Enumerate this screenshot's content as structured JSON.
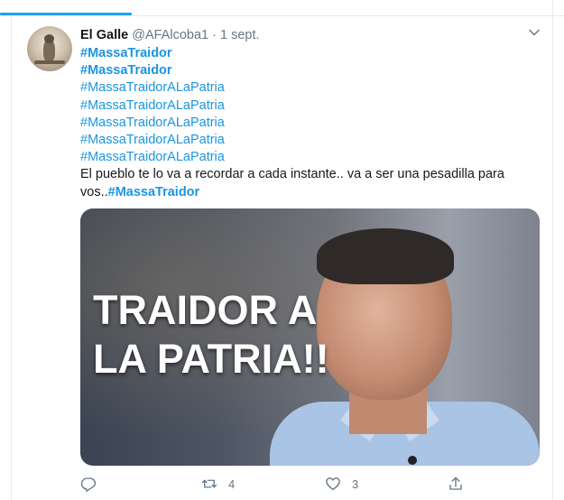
{
  "tweet": {
    "author_name": "El Galle",
    "handle": "@AFAlcoba1",
    "separator": "·",
    "date": "1 sept.",
    "lines": [
      {
        "text": "#MassaTraidor",
        "hashtag": true,
        "bold": true
      },
      {
        "text": "#MassaTraidor",
        "hashtag": true,
        "bold": true
      },
      {
        "text": "#MassaTraidorALaPatria",
        "hashtag": true,
        "bold": false
      },
      {
        "text": "#MassaTraidorALaPatria",
        "hashtag": true,
        "bold": false
      },
      {
        "text": "#MassaTraidorALaPatria",
        "hashtag": true,
        "bold": false
      },
      {
        "text": "#MassaTraidorALaPatria",
        "hashtag": true,
        "bold": false
      },
      {
        "text": "#MassaTraidorALaPatria",
        "hashtag": true,
        "bold": false
      }
    ],
    "body_text": "El pueblo te lo va a recordar a cada instante.. va a ser una pesadilla para",
    "body_text_2": "vos..",
    "body_hashtag": "#MassaTraidor",
    "media_caption_1": "TRAIDOR A",
    "media_caption_2": "LA PATRIA!!",
    "actions": {
      "reply_count": "",
      "retweet_count": "4",
      "like_count": "3",
      "share_count": ""
    }
  },
  "icons": {
    "reply": "reply-icon",
    "retweet": "retweet-icon",
    "like": "heart-icon",
    "share": "share-icon",
    "caret": "chevron-down-icon"
  },
  "colors": {
    "accent": "#1b95e0",
    "tab_underline": "#1da1f2",
    "muted": "#657786",
    "text": "#14171a"
  }
}
